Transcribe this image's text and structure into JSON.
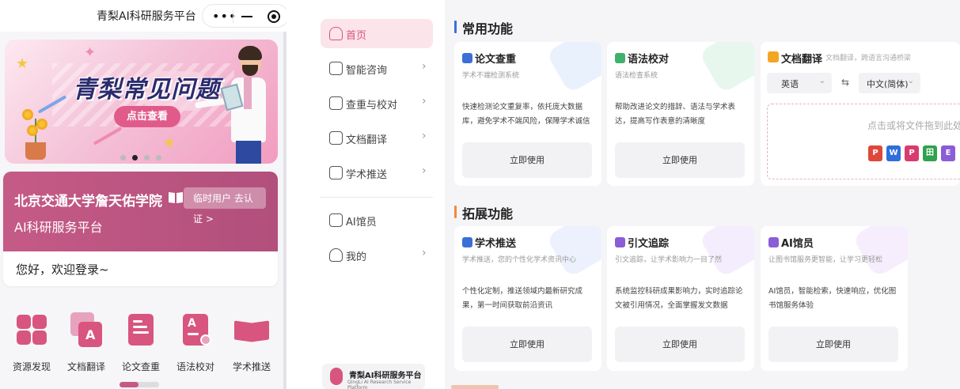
{
  "phone": {
    "app_title": "青梨AI科研服务平台",
    "banner": {
      "title": "青梨常见问题",
      "button": "点击查看"
    },
    "school": {
      "name": "北京交通大学詹天佑学院",
      "subtitle": "AI科研服务平台",
      "badge_line1": "临时用户 去认",
      "badge_line2": "证 >",
      "greeting": "您好，欢迎登录~"
    },
    "shortcuts": [
      {
        "label": "资源发现"
      },
      {
        "label": "文档翻译"
      },
      {
        "label": "论文查重"
      },
      {
        "label": "语法校对"
      },
      {
        "label": "学术推送"
      }
    ]
  },
  "sidebar": {
    "items": [
      {
        "label": "首页"
      },
      {
        "label": "智能咨询"
      },
      {
        "label": "查重与校对"
      },
      {
        "label": "文档翻译"
      },
      {
        "label": "学术推送"
      },
      {
        "label": "AI馆员"
      },
      {
        "label": "我的"
      }
    ],
    "logo_title": "青梨AI科研服务平台",
    "logo_sub": "QingLi AI Research Service Platform"
  },
  "main": {
    "section_common": "常用功能",
    "section_extended": "拓展功能",
    "use_label": "立即使用",
    "common_cards": [
      {
        "title": "论文查重",
        "subtitle": "学术不端检测系统",
        "desc": "快速检测论文重复率，依托庞大数据库，避免学术不端风险，保障学术诚信"
      },
      {
        "title": "语法校对",
        "subtitle": "语法检查系统",
        "desc": "帮助改进论文的措辞、语法与学术表达，提高写作表意的清晰度"
      }
    ],
    "translate": {
      "title": "文档翻译",
      "subtitle": "文档翻译，跨语言沟通桥梁",
      "source_lang": "英语",
      "target_lang": "中文(简体)",
      "swap": "⇆",
      "drop_text": "点击或将文件拖到此处",
      "file_types": [
        "P",
        "W",
        "P",
        "田",
        "E"
      ]
    },
    "extended_cards": [
      {
        "title": "学术推送",
        "subtitle": "学术推送，您的个性化学术资讯中心",
        "desc": "个性化定制，推送领域内最新研究成果，第一时间获取前沿资讯"
      },
      {
        "title": "引文追踪",
        "subtitle": "引文追踪，让学术影响力一目了然",
        "desc": "系统监控科研成果影响力，实时追踪论文被引用情况，全面掌握发文数据"
      },
      {
        "title": "AI馆员",
        "subtitle": "让图书馆服务更智能，让学习更轻松",
        "desc": "AI馆员，智能检索，快速响应，优化图书馆服务体验"
      }
    ]
  }
}
